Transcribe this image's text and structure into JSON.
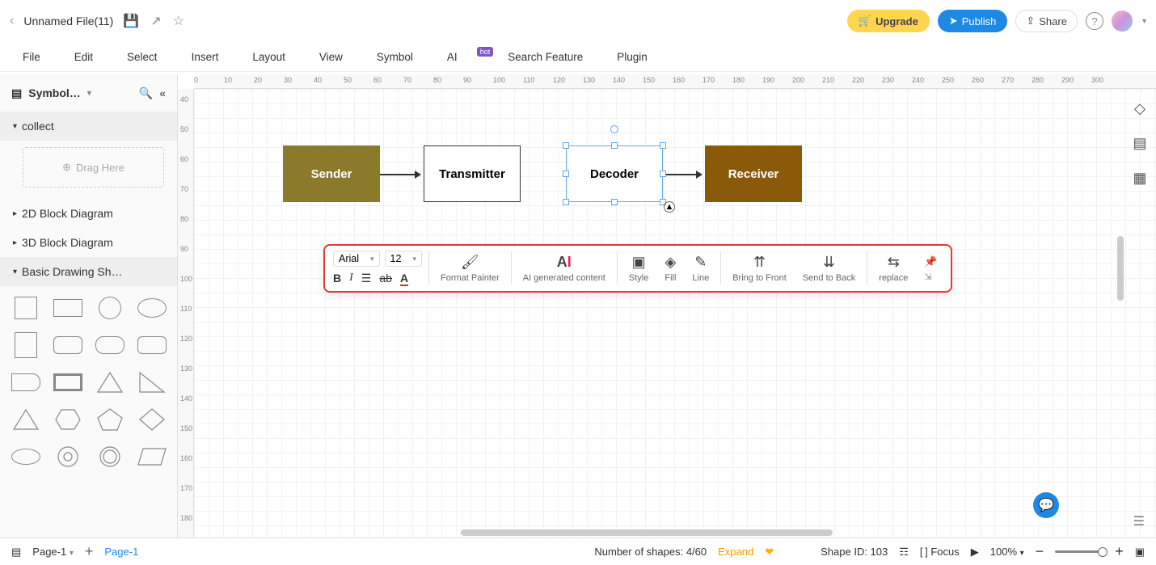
{
  "topbar": {
    "filename": "Unnamed File(11)",
    "upgrade": "Upgrade",
    "publish": "Publish",
    "share": "Share"
  },
  "menu": {
    "file": "File",
    "edit": "Edit",
    "select": "Select",
    "insert": "Insert",
    "layout": "Layout",
    "view": "View",
    "symbol": "Symbol",
    "ai": "AI",
    "ai_badge": "hot",
    "search": "Search Feature",
    "plugin": "Plugin"
  },
  "toolbar": {
    "font": "Arial",
    "size": "12"
  },
  "sidebar": {
    "title": "Symbol…",
    "collect": "collect",
    "drag": "Drag Here",
    "cat_2d": "2D Block Diagram",
    "cat_3d": "3D Block Diagram",
    "cat_basic": "Basic Drawing Sh…"
  },
  "ruler_h": [
    "0",
    "10",
    "20",
    "30",
    "40",
    "50",
    "60",
    "70",
    "80",
    "90",
    "100",
    "110",
    "120",
    "130",
    "140",
    "150",
    "160",
    "170",
    "180",
    "190",
    "200",
    "210",
    "220",
    "230",
    "240",
    "250",
    "260",
    "270",
    "280",
    "290",
    "300"
  ],
  "ruler_v": [
    "40",
    "50",
    "60",
    "70",
    "80",
    "90",
    "100",
    "110",
    "120",
    "130",
    "140",
    "150",
    "160",
    "170",
    "180"
  ],
  "diagram": {
    "sender": "Sender",
    "transmitter": "Transmitter",
    "decoder": "Decoder",
    "receiver": "Receiver"
  },
  "float": {
    "font": "Arial",
    "size": "12",
    "format_painter": "Format Painter",
    "ai_content": "AI generated content",
    "style": "Style",
    "fill": "Fill",
    "line": "Line",
    "front": "Bring to Front",
    "back": "Send to Back",
    "replace": "replace"
  },
  "bottom": {
    "page_select": "Page-1",
    "page_tab": "Page-1",
    "shapes_label": "Number of shapes: 4/60",
    "expand": "Expand",
    "shape_id": "Shape ID: 103",
    "focus": "Focus",
    "zoom": "100%"
  }
}
